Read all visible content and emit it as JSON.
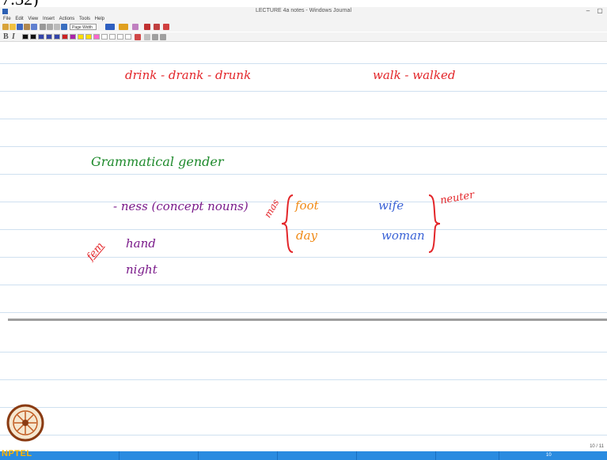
{
  "top_crop_text": "7:32)",
  "window": {
    "title": "LECTURE 4a notes - Windows Journal",
    "minimize": "–",
    "maximize": "▢"
  },
  "menu": [
    "File",
    "Edit",
    "View",
    "Insert",
    "Actions",
    "Tools",
    "Help"
  ],
  "toolbar": {
    "zoom_value": "Page Width"
  },
  "format": {
    "bold": "B",
    "italic": "I"
  },
  "swatches": [
    "#111111",
    "#111111",
    "#3344aa",
    "#3344aa",
    "#3344aa",
    "#cc2222",
    "#aa22aa",
    "#ffdd00",
    "#ffdd00",
    "#ff66cc",
    "#ffffff",
    "#ffffff",
    "#ffffff",
    "#ffffff"
  ],
  "notes": {
    "line1_left": "drink - drank - drunk",
    "line1_right": "walk - walked",
    "heading": "Grammatical gender",
    "ness": "- ness  (concept nouns)",
    "fem": "fem",
    "mas": "mas",
    "foot": "foot",
    "day": "day",
    "wife": "wife",
    "woman": "woman",
    "neuter": "neuter",
    "hand": "hand",
    "night": "night"
  },
  "page_number": "10 / 11",
  "footer": {
    "logo_text": "NPTEL",
    "taskbar_number": "10"
  }
}
